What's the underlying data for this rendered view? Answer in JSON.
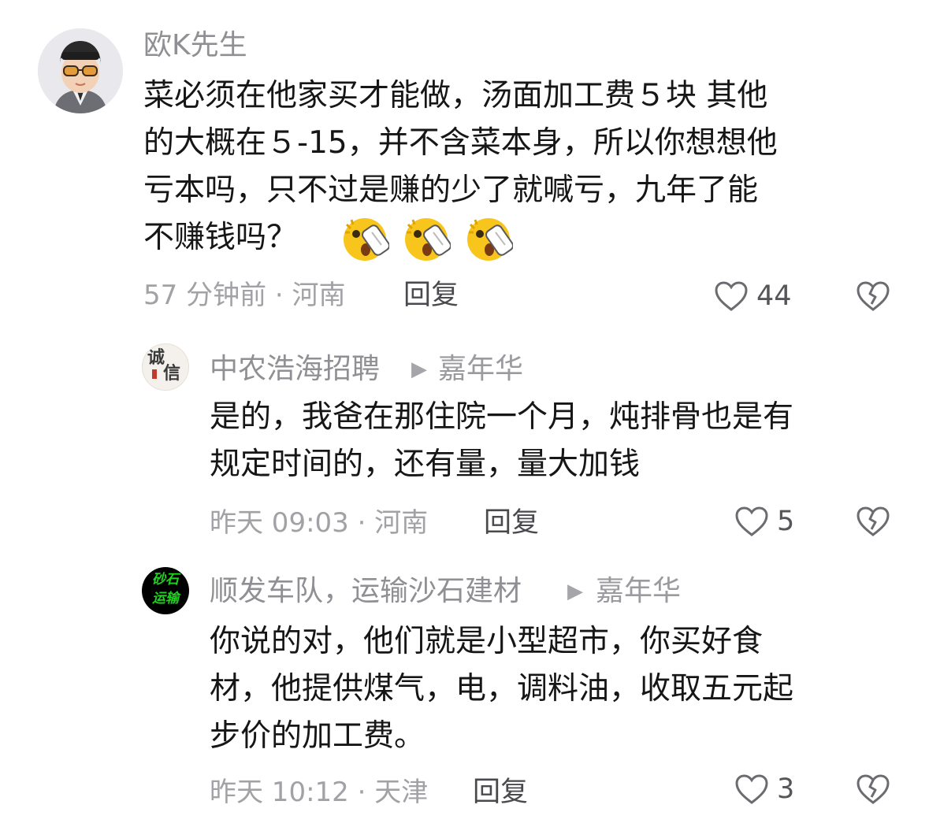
{
  "comments": [
    {
      "username": "欧K先生",
      "lines": [
        "菜必须在他家买才能做，汤面加工费５块 其他",
        "的大概在５-15，并不含菜本身，所以你想想他",
        "亏本吗，只不过是赚的少了就喊亏，九年了能",
        "不赚钱吗？"
      ],
      "emoji_icon": "surprised-face-emoji",
      "time_location": "57 分钟前 · 河南",
      "reply_label": "回复",
      "likes": "44"
    }
  ],
  "replies": [
    {
      "username": "中农浩海招聘",
      "badge": "嘉年华",
      "avatar_text": [
        "诚",
        "信"
      ],
      "lines": [
        "是的，我爸在那住院一个月，炖排骨也是有",
        "规定时间的，还有量，量大加钱"
      ],
      "time_location": "昨天 09:03 · 河南",
      "reply_label": "回复",
      "likes": "5"
    },
    {
      "username": "顺发车队，运输沙石建材",
      "badge": "嘉年华",
      "avatar_text": [
        "砂石",
        "运输"
      ],
      "lines": [
        "你说的对，他们就是小型超市，你买好食",
        "材，他提供煤气，电，调料油，收取五元起",
        "步价的加工费。"
      ],
      "time_location": "昨天 10:12 · 天津",
      "reply_label": "回复",
      "likes": "3"
    }
  ],
  "icons": {
    "like": "heart-outline-icon",
    "dislike": "broken-heart-icon",
    "badge_arrow": "play-triangle-icon"
  },
  "colors": {
    "username": "#8f8f94",
    "text": "#161616",
    "meta": "#a2a2a6",
    "avatar_green_text": "#1fd41f"
  }
}
